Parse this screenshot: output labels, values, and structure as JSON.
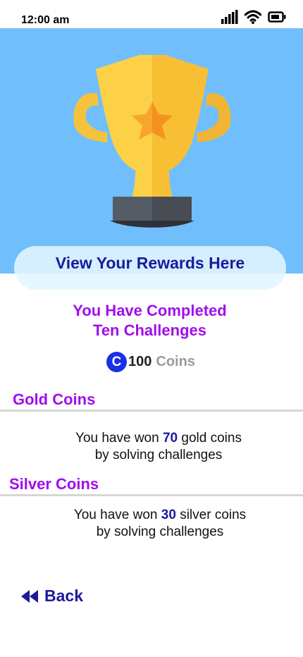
{
  "status_bar": {
    "time": "12:00 am",
    "icons": [
      "signal-icon",
      "wifi-icon",
      "battery-icon"
    ]
  },
  "hero": {
    "image": "trophy-icon",
    "background": "#70bffc"
  },
  "rewards_banner": {
    "label": "View Your Rewards Here"
  },
  "summary": {
    "title_line1": "You Have Completed",
    "title_line2": "Ten Challenges",
    "coin_symbol": "C",
    "coin_amount": "100",
    "coin_unit": "Coins"
  },
  "sections": [
    {
      "title": "Gold Coins",
      "text_prefix": "You have won",
      "amount": "70",
      "text_suffix": "gold coins",
      "text_line2": "by solving challenges"
    },
    {
      "title": "Silver Coins",
      "text_prefix": "You have won",
      "amount": "30",
      "text_suffix": "silver coins",
      "text_line2": "by solving challenges"
    }
  ],
  "back": {
    "label": "Back",
    "icon": "rewind-icon"
  },
  "colors": {
    "accent_purple": "#a10ded",
    "navy": "#1c1a9e",
    "coin_blue": "#1830e6"
  }
}
